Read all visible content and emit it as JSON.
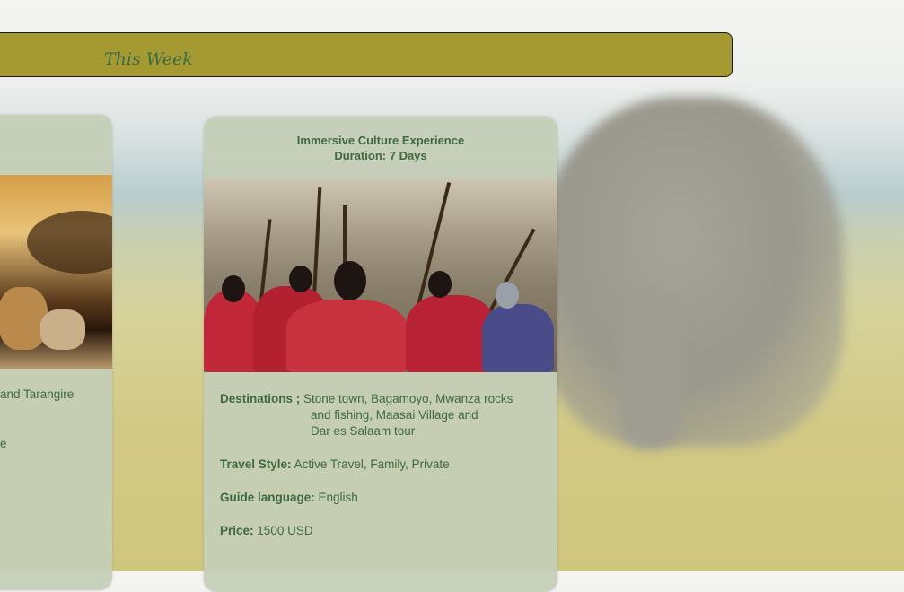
{
  "banner": {
    "title": "This Week"
  },
  "left_card": {
    "line1": "and Tarangire",
    "line2": "e"
  },
  "main_card": {
    "title": "Immersive Culture Experience",
    "duration": "Duration: 7 Days",
    "destinations_label": "Destinations ;",
    "destinations_lines": [
      "Stone town, Bagamoyo, Mwanza rocks",
      "and fishing, Maasai Village and",
      "Dar es Salaam tour"
    ],
    "travel_style_label": "Travel Style:",
    "travel_style": "Active Travel, Family, Private",
    "guide_language_label": "Guide language:",
    "guide_language": "English",
    "price_label": "Price:",
    "price": "1500 USD"
  },
  "colors": {
    "banner": "#a59a31",
    "text": "#3e6a3e",
    "card": "#c4cdb7"
  }
}
